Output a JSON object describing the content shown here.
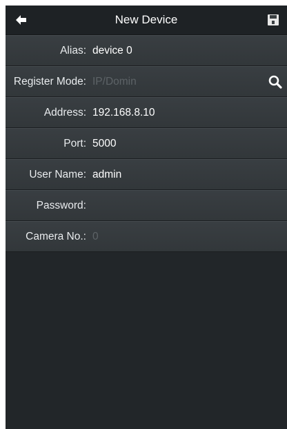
{
  "header": {
    "title": "New Device",
    "back_icon": "back-arrow-icon",
    "save_icon": "save-floppy-icon"
  },
  "fields": [
    {
      "label": "Alias:",
      "value": "device 0",
      "placeholder": ""
    },
    {
      "label": "Register Mode:",
      "value": "",
      "placeholder": "IP/Domin",
      "icon": "search-icon"
    },
    {
      "label": "Address:",
      "value": "192.168.8.10",
      "placeholder": ""
    },
    {
      "label": "Port:",
      "value": "5000",
      "placeholder": ""
    },
    {
      "label": "User Name:",
      "value": "admin",
      "placeholder": ""
    },
    {
      "label": "Password:",
      "value": "",
      "placeholder": ""
    },
    {
      "label": "Camera No.:",
      "value": "",
      "placeholder": "0"
    }
  ],
  "colors": {
    "background": "#202427",
    "row": "#363b3e",
    "text": "#ffffff",
    "placeholder": "#5d6367"
  }
}
